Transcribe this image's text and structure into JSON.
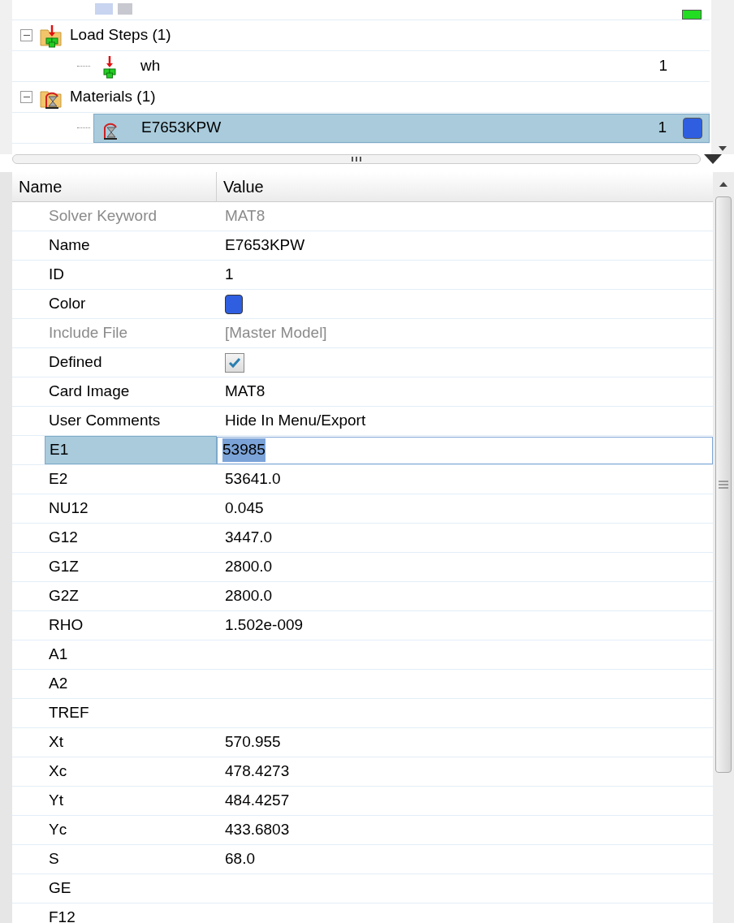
{
  "tree": {
    "items": [
      {
        "label": "Load Steps (1)",
        "kind": "loadstep",
        "expanded": true,
        "selected": false,
        "children": [
          {
            "label": "wh",
            "kind": "loadstep",
            "count": "1",
            "selected": false
          }
        ]
      },
      {
        "label": "Materials (1)",
        "kind": "material",
        "expanded": true,
        "selected": false,
        "children": [
          {
            "label": "E7653KPW",
            "kind": "material",
            "count": "1",
            "color": "#2f5fe0",
            "selected": true
          }
        ]
      }
    ]
  },
  "grid": {
    "columns": [
      "Name",
      "Value"
    ],
    "rows": [
      {
        "name": "Solver Keyword",
        "value": "MAT8",
        "kind": "text",
        "disabled": true,
        "selected": false
      },
      {
        "name": "Name",
        "value": "E7653KPW",
        "kind": "text",
        "disabled": false,
        "selected": false
      },
      {
        "name": "ID",
        "value": "1",
        "kind": "text",
        "disabled": false,
        "selected": false
      },
      {
        "name": "Color",
        "kind": "color",
        "color": "#2f5fe0",
        "disabled": false,
        "selected": false
      },
      {
        "name": "Include File",
        "value": "[Master Model]",
        "kind": "text",
        "disabled": true,
        "selected": false
      },
      {
        "name": "Defined",
        "kind": "checkbox",
        "checked": true,
        "disabled": false,
        "selected": false
      },
      {
        "name": "Card Image",
        "value": "MAT8",
        "kind": "text",
        "disabled": false,
        "selected": false
      },
      {
        "name": "User Comments",
        "value": "Hide In Menu/Export",
        "kind": "text",
        "disabled": false,
        "selected": false
      },
      {
        "name": "E1",
        "value": "53985",
        "kind": "edit",
        "disabled": false,
        "selected": true
      },
      {
        "name": "E2",
        "value": "53641.0",
        "kind": "text",
        "disabled": false,
        "selected": false
      },
      {
        "name": "NU12",
        "value": "0.045",
        "kind": "text",
        "disabled": false,
        "selected": false
      },
      {
        "name": "G12",
        "value": "3447.0",
        "kind": "text",
        "disabled": false,
        "selected": false
      },
      {
        "name": "G1Z",
        "value": "2800.0",
        "kind": "text",
        "disabled": false,
        "selected": false
      },
      {
        "name": "G2Z",
        "value": "2800.0",
        "kind": "text",
        "disabled": false,
        "selected": false
      },
      {
        "name": "RHO",
        "value": "1.502e-009",
        "kind": "text",
        "disabled": false,
        "selected": false
      },
      {
        "name": "A1",
        "kind": "text",
        "disabled": false,
        "selected": false
      },
      {
        "name": "A2",
        "kind": "text",
        "disabled": false,
        "selected": false
      },
      {
        "name": "TREF",
        "kind": "text",
        "disabled": false,
        "selected": false
      },
      {
        "name": "Xt",
        "value": "570.955",
        "kind": "text",
        "disabled": false,
        "selected": false
      },
      {
        "name": "Xc",
        "value": "478.4273",
        "kind": "text",
        "disabled": false,
        "selected": false
      },
      {
        "name": "Yt",
        "value": "484.4257",
        "kind": "text",
        "disabled": false,
        "selected": false
      },
      {
        "name": "Yc",
        "value": "433.6803",
        "kind": "text",
        "disabled": false,
        "selected": false
      },
      {
        "name": "S",
        "value": "68.0",
        "kind": "text",
        "disabled": false,
        "selected": false
      },
      {
        "name": "GE",
        "kind": "text",
        "disabled": false,
        "selected": false
      },
      {
        "name": "F12",
        "kind": "text",
        "disabled": false,
        "selected": false
      }
    ]
  }
}
